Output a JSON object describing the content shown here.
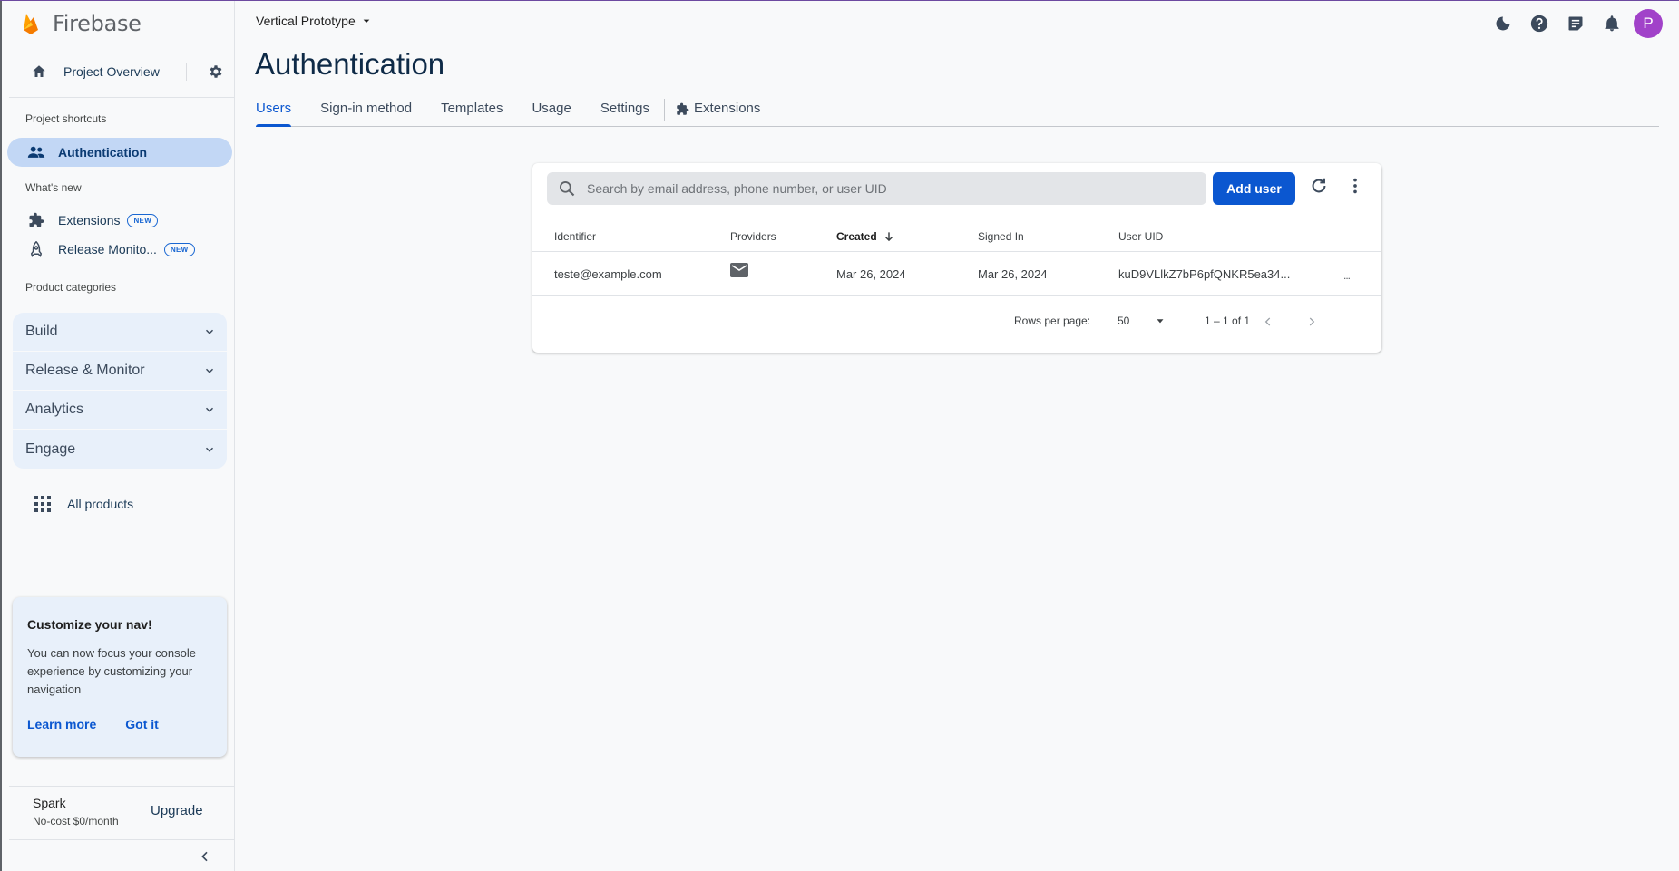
{
  "brand": {
    "name": "Firebase"
  },
  "sidebar": {
    "project_overview": "Project Overview",
    "project_shortcuts_label": "Project shortcuts",
    "shortcuts": [
      {
        "label": "Authentication",
        "icon": "people-icon",
        "active": true
      }
    ],
    "whats_new_label": "What's new",
    "whats_new": [
      {
        "label": "Extensions",
        "badge": "NEW",
        "icon": "puzzle-icon"
      },
      {
        "label": "Release Monito...",
        "badge": "NEW",
        "icon": "rocket-icon"
      }
    ],
    "product_categories_label": "Product categories",
    "categories": [
      {
        "label": "Build"
      },
      {
        "label": "Release & Monitor"
      },
      {
        "label": "Analytics"
      },
      {
        "label": "Engage"
      }
    ],
    "all_products": "All products",
    "promo": {
      "title": "Customize your nav!",
      "body": "You can now focus your console experience by customizing your navigation",
      "learn_more": "Learn more",
      "got_it": "Got it"
    },
    "plan": {
      "name": "Spark",
      "desc": "No-cost $0/month",
      "upgrade": "Upgrade"
    }
  },
  "header": {
    "project_name": "Vertical Prototype",
    "avatar_letter": "P",
    "page_title": "Authentication",
    "tabs": [
      "Users",
      "Sign-in method",
      "Templates",
      "Usage",
      "Settings"
    ],
    "extensions_tab": "Extensions"
  },
  "users": {
    "search_placeholder": "Search by email address, phone number, or user UID",
    "add_user": "Add user",
    "columns": {
      "identifier": "Identifier",
      "providers": "Providers",
      "created": "Created",
      "signed_in": "Signed In",
      "user_uid": "User UID"
    },
    "rows": [
      {
        "identifier": "teste@example.com",
        "provider_icon": "mail-icon",
        "created": "Mar 26, 2024",
        "signed_in": "Mar 26, 2024",
        "uid": "kuD9VLlkZ7bP6pfQNKR5ea34..."
      }
    ],
    "row_more": "...",
    "rows_per_page_label": "Rows per page:",
    "rows_per_page": "50",
    "range": "1 – 1 of 1"
  },
  "colors": {
    "accent": "#0b57d0",
    "active_nav": "#c2d7f5",
    "avatar": "#a142c9",
    "category_bg": "#e8f0fa"
  }
}
